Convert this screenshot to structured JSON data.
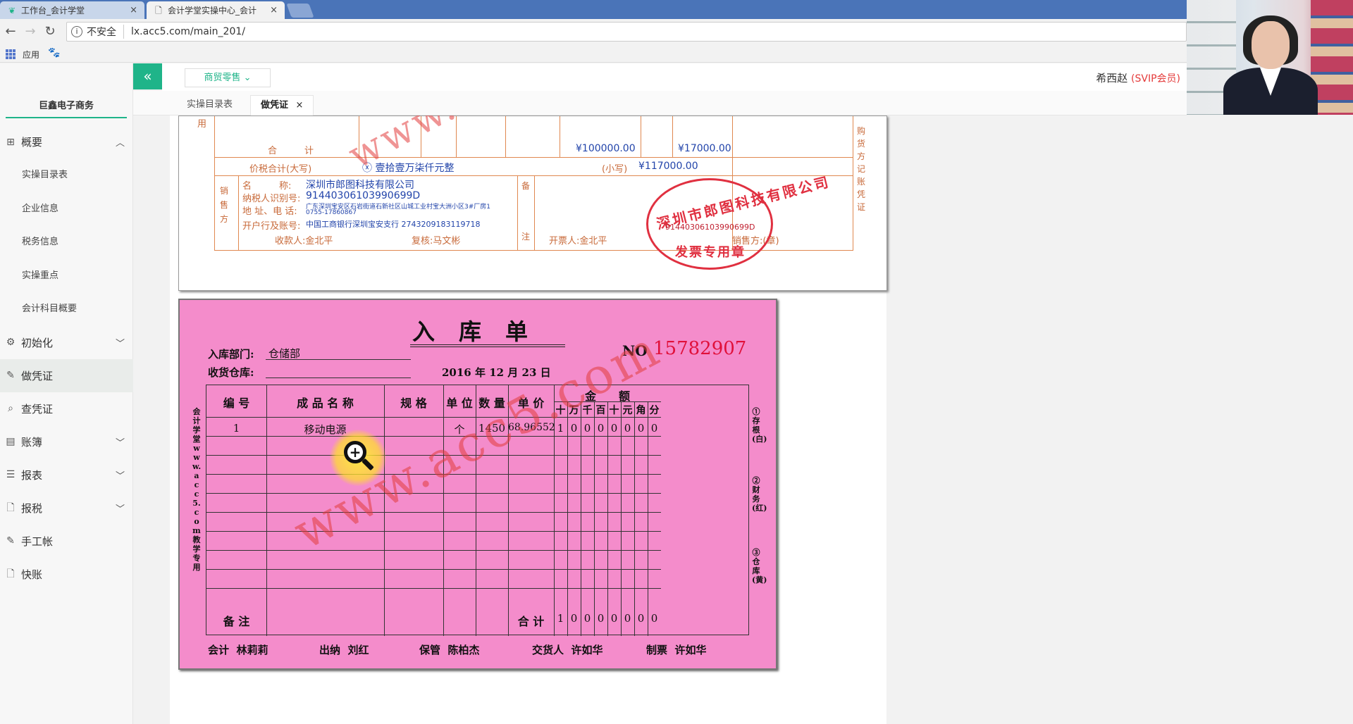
{
  "browser": {
    "tabs": [
      {
        "title": "工作台_会计学堂",
        "close": "×"
      },
      {
        "title": "会计学堂实操中心_会计",
        "close": "×"
      }
    ],
    "insecure_label": "不安全",
    "url": "lx.acc5.com/main_201/",
    "bookmarks": {
      "apps": "应用"
    }
  },
  "app": {
    "company": "巨鑫电子商务",
    "biz_select": "商贸零售",
    "user_name": "希西赵",
    "user_badge": "(SVIP会员)",
    "collapse_icon": "«",
    "tabs": [
      {
        "label": "实操目录表"
      },
      {
        "label": "做凭证",
        "close": "×"
      }
    ],
    "menu": [
      {
        "label": "概要",
        "icon": "grid-icon",
        "chevron": "︿"
      },
      {
        "label": "初始化",
        "icon": "gear-icon",
        "chevron": "﹀"
      },
      {
        "label": "做凭证",
        "icon": "pen-icon"
      },
      {
        "label": "查凭证",
        "icon": "search-icon"
      },
      {
        "label": "账簿",
        "icon": "book-icon",
        "chevron": "﹀"
      },
      {
        "label": "报表",
        "icon": "report-icon",
        "chevron": "﹀"
      },
      {
        "label": "报税",
        "icon": "file-icon",
        "chevron": "﹀"
      },
      {
        "label": "手工帐",
        "icon": "pen-icon"
      },
      {
        "label": "快账",
        "icon": "file-icon"
      }
    ],
    "submenu": [
      "实操目录表",
      "企业信息",
      "税务信息",
      "实操重点",
      "会计科目概要"
    ]
  },
  "invoice": {
    "top_char": "用",
    "total_label": "合　　　计",
    "amount_total": "¥100000.00",
    "tax_total": "¥17000.00",
    "price_tax_label": "价税合计(大写)",
    "price_tax_words": "ⓧ 壹拾壹万柒仟元整",
    "small_label": "(小写)",
    "small_amount": "¥117000.00",
    "seller_side": "销售方",
    "name_label": "名　　　称:",
    "name_val": "深圳市郎图科技有限公司",
    "tax_id_label": "纳税人识别号:",
    "tax_id_val": "91440306103990699D",
    "addr_label": "地 址、电 话:",
    "addr_val1": "广东深圳宝安区石岩街道石新社区山城工业村宝大洲小区3#厂房1",
    "addr_val2": "0755-17860867",
    "bank_label": "开户行及账号:",
    "bank_val": "中国工商银行深圳宝安支行 2743209183119718",
    "note_label": "备",
    "note_label2": "注",
    "payee": "收款人:金北平",
    "reviewer": "复核:马文彬",
    "drawer": "开票人:金北平",
    "seller_seal": "销售方:(章)",
    "right_side": "购货方记账凭证",
    "stamp_ring": "深圳市郎图科技有限公司",
    "stamp_num": "91440306103990699D",
    "stamp_text": "发票专用章"
  },
  "receipt": {
    "title": "入库单",
    "no_label": "NO",
    "no": "15782907",
    "dept_label": "入库部门:",
    "dept": "仓储部",
    "wh_label": "收货仓库:",
    "date": "2016 年 12 月 23 日",
    "headers": {
      "code": "编 号",
      "name": "成 品 名 称",
      "spec": "规 格",
      "unit": "单 位",
      "qty": "数 量",
      "price": "单 价",
      "amount": "金　　额",
      "digits": [
        "十",
        "万",
        "千",
        "百",
        "十",
        "元",
        "角",
        "分"
      ]
    },
    "rows": [
      {
        "code": "1",
        "name": "移动电源",
        "spec": "",
        "unit": "个",
        "qty": "1450",
        "price": "68.96552",
        "digits": [
          "1",
          "0",
          "0",
          "0",
          "0",
          "0",
          "0",
          "0"
        ]
      }
    ],
    "note_label": "备 注",
    "total_label": "合 计",
    "total_digits": [
      "1",
      "0",
      "0",
      "0",
      "0",
      "0",
      "0",
      "0"
    ],
    "left_side": "会计学堂www.acc5.com教学专用",
    "right_side1": "①存根(白)",
    "right_side2": "②财务(红)",
    "right_side3": "③仓库(黄)",
    "signatures": [
      {
        "label": "会计",
        "name": "林莉莉"
      },
      {
        "label": "出纳",
        "name": "刘红"
      },
      {
        "label": "保管",
        "name": "陈柏杰"
      },
      {
        "label": "交货人",
        "name": "许如华"
      },
      {
        "label": "制票",
        "name": "许如华"
      }
    ]
  },
  "watermark": {
    "text1": "www.",
    "text2": "www.acc5.com"
  }
}
